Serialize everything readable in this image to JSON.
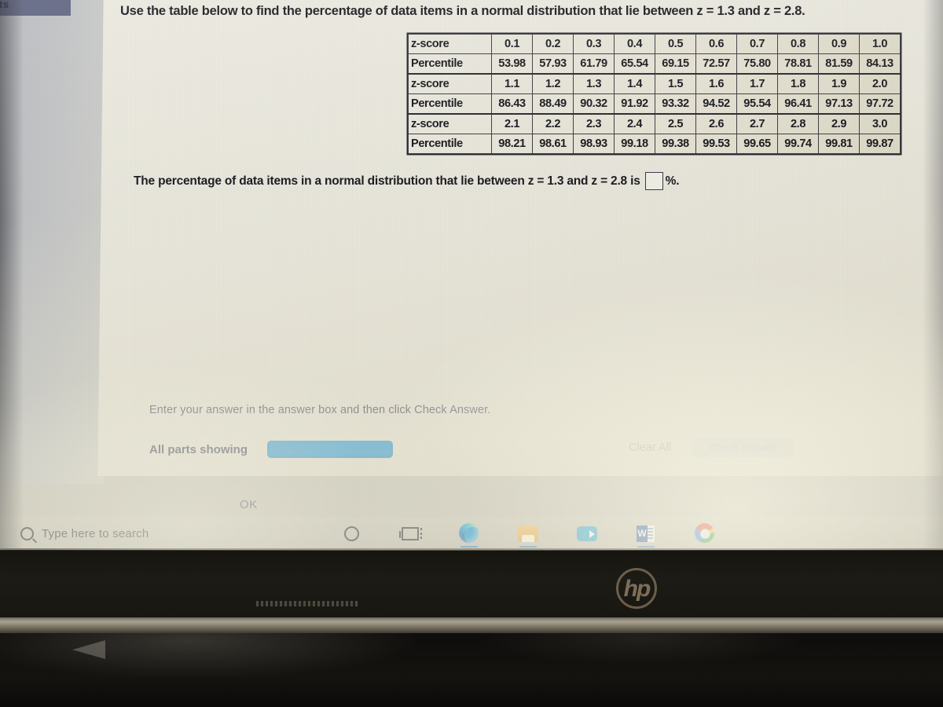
{
  "app_bar": {
    "fragment_text": "ts"
  },
  "question": {
    "text": "Use the table below to find the percentage of data items in a normal distribution that lie between z = 1.3 and z = 2.8."
  },
  "ztable": {
    "row_label_z": "z-score",
    "row_label_p": "Percentile",
    "blocks": [
      {
        "z": [
          "0.1",
          "0.2",
          "0.3",
          "0.4",
          "0.5",
          "0.6",
          "0.7",
          "0.8",
          "0.9",
          "1.0"
        ],
        "percentile": [
          "53.98",
          "57.93",
          "61.79",
          "65.54",
          "69.15",
          "72.57",
          "75.80",
          "78.81",
          "81.59",
          "84.13"
        ]
      },
      {
        "z": [
          "1.1",
          "1.2",
          "1.3",
          "1.4",
          "1.5",
          "1.6",
          "1.7",
          "1.8",
          "1.9",
          "2.0"
        ],
        "percentile": [
          "86.43",
          "88.49",
          "90.32",
          "91.92",
          "93.32",
          "94.52",
          "95.54",
          "96.41",
          "97.13",
          "97.72"
        ]
      },
      {
        "z": [
          "2.1",
          "2.2",
          "2.3",
          "2.4",
          "2.5",
          "2.6",
          "2.7",
          "2.8",
          "2.9",
          "3.0"
        ],
        "percentile": [
          "98.21",
          "98.61",
          "98.93",
          "99.18",
          "99.38",
          "99.53",
          "99.65",
          "99.74",
          "99.81",
          "99.87"
        ]
      }
    ]
  },
  "answer": {
    "sentence_before": "The percentage of data items in a normal distribution that lie between z = 1.3 and z = 2.8 is",
    "input_value": "",
    "input_placeholder": "",
    "sentence_after": "%."
  },
  "footer": {
    "instruction": "Enter your answer in the answer box and then click Check Answer.",
    "parts_label": "All parts showing",
    "primary_button_label": "",
    "clear_all_label": "Clear All",
    "check_answer_label": "Check Answer",
    "ok_label": "OK"
  },
  "taskbar": {
    "search_placeholder": "Type here to search",
    "search_icon": "search-icon",
    "icons": [
      {
        "name": "cortana-icon",
        "label": "Cortana"
      },
      {
        "name": "task-view-icon",
        "label": "Task View"
      },
      {
        "name": "microsoft-edge-icon",
        "label": "Microsoft Edge"
      },
      {
        "name": "file-explorer-icon",
        "label": "File Explorer"
      },
      {
        "name": "zoom-icon",
        "label": "Zoom"
      },
      {
        "name": "microsoft-word-icon",
        "label": "Microsoft Word"
      },
      {
        "name": "google-chrome-icon",
        "label": "Google Chrome"
      }
    ]
  },
  "hardware": {
    "brand_logo": "hp"
  },
  "colors": {
    "accent_blue": "#4fa7d6",
    "screen_bg": "#e7e5da",
    "text": "#16161c",
    "muted_text": "#70707e",
    "table_border": "#26262c"
  }
}
